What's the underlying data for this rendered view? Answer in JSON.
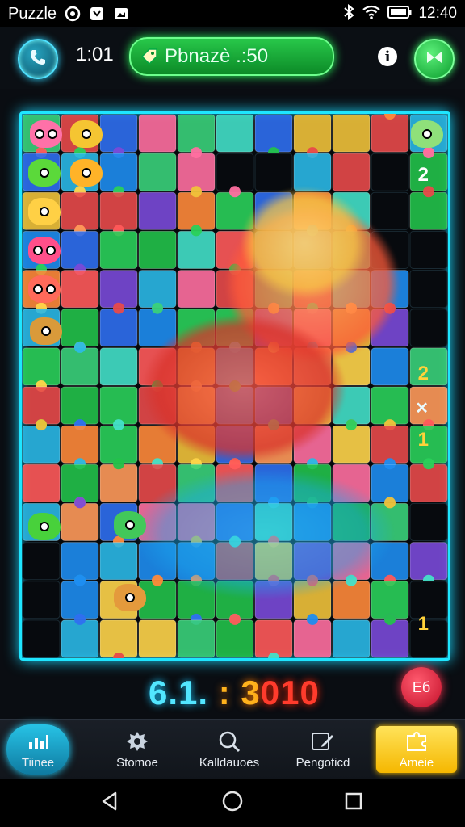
{
  "status_bar": {
    "app_name": "Puzzle",
    "time": "12:40",
    "icons": [
      "target-icon",
      "shield-icon",
      "image-icon",
      "bluetooth-icon",
      "wifi-icon",
      "battery-icon"
    ]
  },
  "top_bar": {
    "timer": "1:01",
    "title_pill": "Pbnazè .:50",
    "info_label": "i"
  },
  "board": {
    "cols": 11,
    "rows": 14,
    "side_numbers": [
      "2",
      "2",
      "1",
      "1"
    ],
    "side_symbol": "✕"
  },
  "score": {
    "part_a": "6.1.",
    "part_b": " : 3",
    "part_c": "010"
  },
  "action_button": "Eб",
  "bottom_nav": {
    "items": [
      {
        "label": "Tiinee",
        "icon": "chart-icon"
      },
      {
        "label": "Stomoe",
        "icon": "gear-icon"
      },
      {
        "label": "Kalldauoes",
        "icon": "search-icon"
      },
      {
        "label": "Pengoticd",
        "icon": "edit-icon"
      },
      {
        "label": "Ameie",
        "icon": "puzzle-icon"
      }
    ]
  },
  "colors": {
    "accent_cyan": "#1ee6ff",
    "accent_green": "#27c84a",
    "accent_yellow": "#ffc400",
    "accent_red": "#ff3450"
  }
}
